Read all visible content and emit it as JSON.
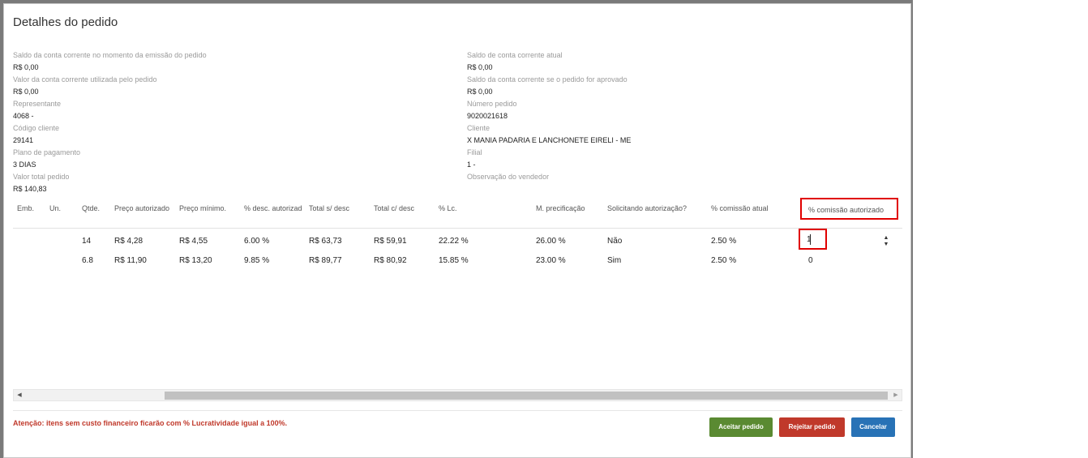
{
  "dialog": {
    "title": "Detalhes do pedido"
  },
  "left_fields": [
    {
      "label": "Saldo da conta corrente no momento da emissão do pedido",
      "value": "R$ 0,00"
    },
    {
      "label": "Valor da conta corrente utilizada pelo pedido",
      "value": "R$ 0,00"
    },
    {
      "label": "Representante",
      "value": "4068 -"
    },
    {
      "label": "Código cliente",
      "value": "29141"
    },
    {
      "label": "Plano de pagamento",
      "value": "3 DIAS"
    },
    {
      "label": "Valor total pedido",
      "value": "R$ 140,83"
    }
  ],
  "right_fields": [
    {
      "label": "Saldo de conta corrente atual",
      "value": "R$ 0,00"
    },
    {
      "label": "Saldo da conta corrente se o pedido for aprovado",
      "value": "R$ 0,00"
    },
    {
      "label": "Número pedido",
      "value": "9020021618"
    },
    {
      "label": "Cliente",
      "value": "X MANIA PADARIA E LANCHONETE EIRELI - ME"
    },
    {
      "label": "Filial",
      "value": "1 -"
    },
    {
      "label": "Observação do vendedor",
      "value": ""
    }
  ],
  "table": {
    "headers": [
      "Emb.",
      "Un.",
      "Qtde.",
      "Preço autorizado",
      "Preço mínimo.",
      "% desc. autorizado",
      "Total s/ desc",
      "Total c/ desc",
      "% Lc.",
      "M. precificação",
      "Solicitando autorização?",
      "% comissão atual",
      "% comissão autorizado"
    ],
    "rows": [
      [
        "",
        "",
        "14",
        "R$ 4,28",
        "R$ 4,55",
        "6.00 %",
        "R$ 63,73",
        "R$ 59,91",
        "22.22 %",
        "26.00 %",
        "Não",
        "2.50 %",
        "1"
      ],
      [
        "",
        "",
        "6.8",
        "R$ 11,90",
        "R$ 13,20",
        "9.85 %",
        "R$ 89,77",
        "R$ 80,92",
        "15.85 %",
        "23.00 %",
        "Sim",
        "2.50 %",
        "0"
      ]
    ]
  },
  "footer": {
    "warning": "Atenção: itens sem custo financeiro ficarão com % Lucratividade igual a 100%.",
    "accept_label": "Aceitar pedido",
    "reject_label": "Rejeitar pedido",
    "cancel_label": "Cancelar"
  },
  "icons": {
    "scroll_left": "chevron-left-icon",
    "scroll_right": "chevron-right-icon",
    "spinner": "spinner-arrows-icon"
  },
  "colors": {
    "accept": "#5a8a32",
    "reject": "#c0392b",
    "cancel": "#2872b6",
    "highlight": "#e00000",
    "warning": "#c0392b"
  }
}
